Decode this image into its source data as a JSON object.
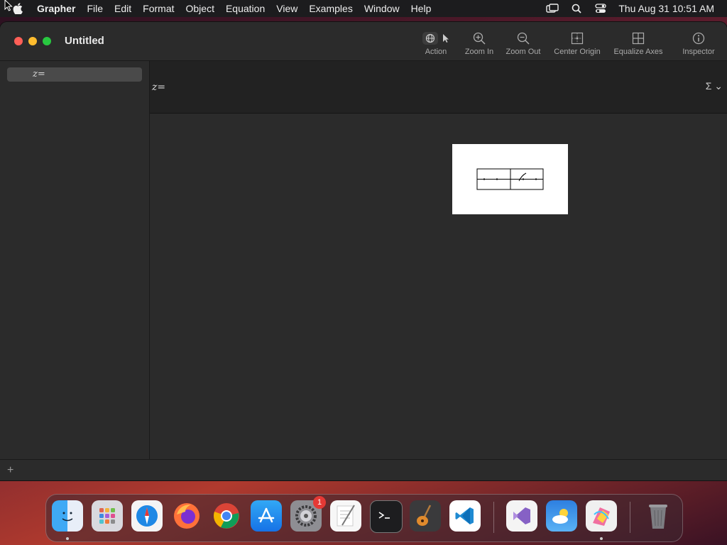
{
  "menubar": {
    "app_name": "Grapher",
    "items": [
      "File",
      "Edit",
      "Format",
      "Object",
      "Equation",
      "View",
      "Examples",
      "Window",
      "Help"
    ],
    "clock": "Thu Aug 31  10:51 AM"
  },
  "window": {
    "title": "Untitled"
  },
  "toolbar": {
    "action_label": "Action",
    "zoom_in_label": "Zoom In",
    "zoom_out_label": "Zoom Out",
    "center_origin_label": "Center Origin",
    "equalize_axes_label": "Equalize Axes",
    "inspector_label": "Inspector"
  },
  "sidebar": {
    "equation_row": "z="
  },
  "equation_bar": {
    "label": "z=",
    "sigma": "Σ ⌄"
  },
  "bottombar": {
    "add_label": "+"
  },
  "dock": {
    "settings_badge": "1"
  }
}
